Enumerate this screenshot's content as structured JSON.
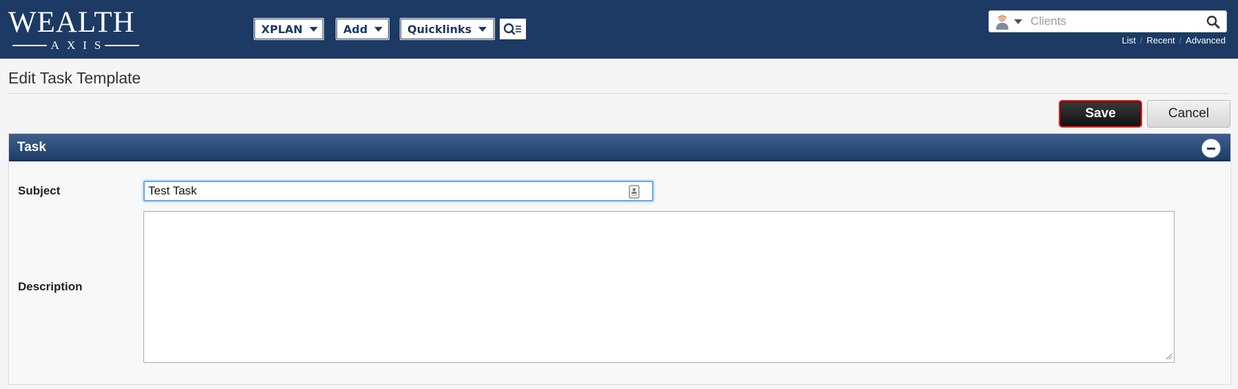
{
  "header": {
    "logo": {
      "word": "WEALTH",
      "sub": "AXIS"
    },
    "nav": [
      {
        "label": "XPLAN"
      },
      {
        "label": "Add"
      },
      {
        "label": "Quicklinks"
      }
    ],
    "client_search": {
      "placeholder": "Clients",
      "links": [
        "List",
        "Recent",
        "Advanced"
      ]
    }
  },
  "page": {
    "title": "Edit Task Template",
    "save_label": "Save",
    "cancel_label": "Cancel"
  },
  "panel": {
    "title": "Task",
    "subject_label": "Subject",
    "subject_value": "Test Task",
    "description_label": "Description",
    "description_value": ""
  },
  "colors": {
    "topbar": "#1c3a63",
    "panel_header": "#2c4c78",
    "save_highlight": "#e02020"
  }
}
